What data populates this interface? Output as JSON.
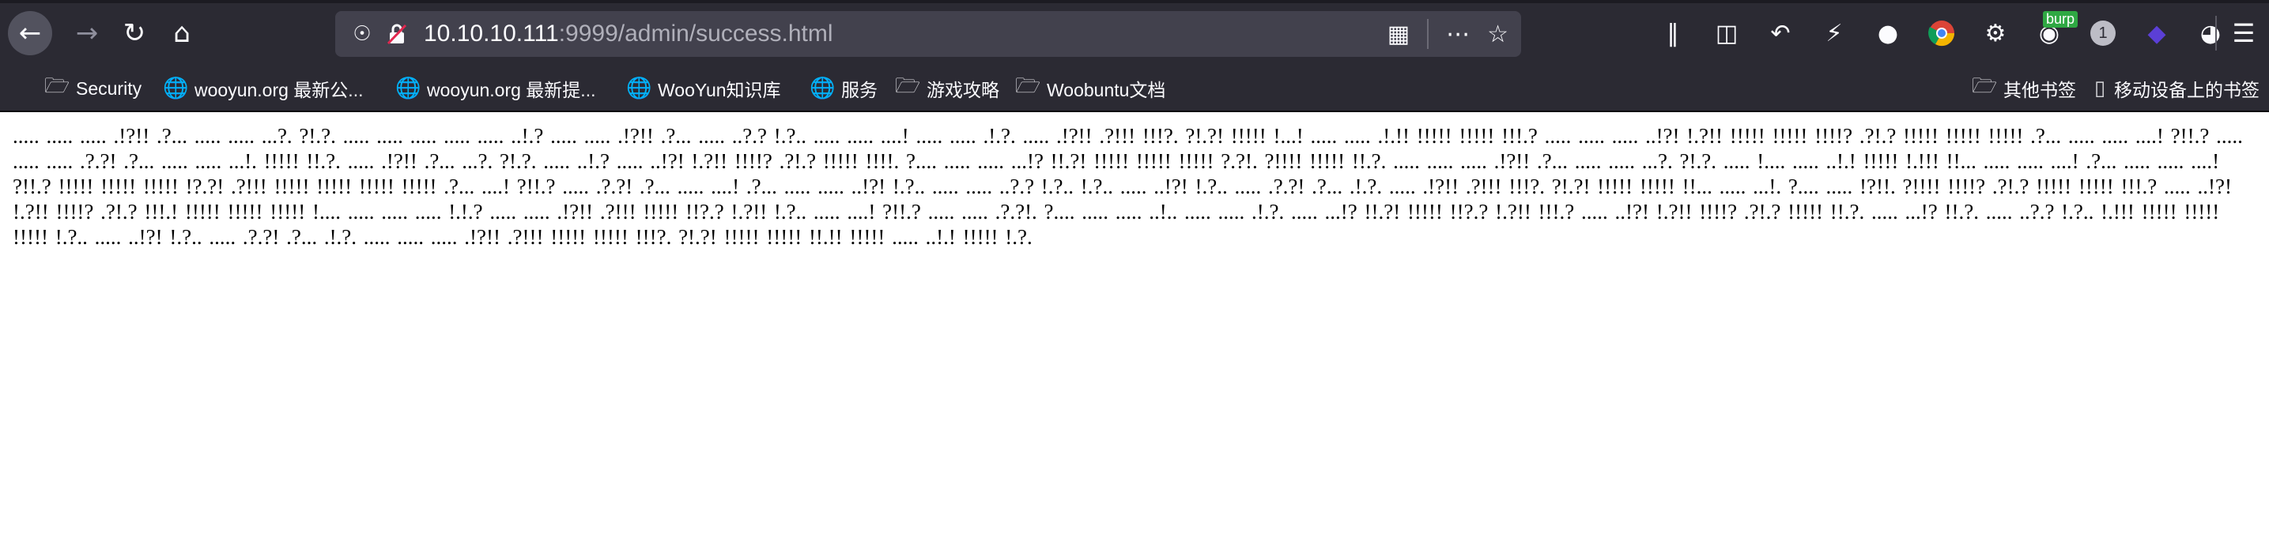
{
  "toolbar": {
    "back_icon": "back-arrow-icon",
    "forward_icon": "forward-arrow-icon",
    "reload_icon": "reload-icon",
    "home_icon": "home-icon",
    "url_host": "10.10.10.111",
    "url_rest": ":9999/admin/success.html",
    "burp_badge": "burp",
    "notification_count": "1"
  },
  "bookmarks": [
    {
      "label": "Security",
      "icon": "folder-icon"
    },
    {
      "label": "wooyun.org 最新公...",
      "icon": "globe-icon"
    },
    {
      "label": "wooyun.org 最新提...",
      "icon": "globe-icon"
    },
    {
      "label": "WooYun知识库",
      "icon": "globe-icon"
    },
    {
      "label": "服务",
      "icon": "globe-icon"
    },
    {
      "label": "游戏攻略",
      "icon": "folder-icon"
    },
    {
      "label": "Woobuntu文档",
      "icon": "folder-icon"
    }
  ],
  "bookmarks_right": [
    {
      "label": "其他书签",
      "icon": "folder-icon"
    },
    {
      "label": "移动设备上的书签",
      "icon": "mobile-bookmark-icon"
    }
  ],
  "page": {
    "text": "..... ..... ..... .!?!! .?... ..... ..... ...?. ?!.?. ..... ..... ..... ..... ..... ..!.? ..... ..... .!?!! .?... ..... ..?.? !.?.. ..... ..... ....! ..... ..... .!.?. ..... .!?!! .?!!! !!!?. ?!.?! !!!!! !...! ..... ..... .!.!! !!!!! !!!!! !!!.? ..... ..... ..... ..!?! !.?!! !!!!! !!!!! !!!!? .?!.? !!!!! !!!!! !!!!! .?... ..... ..... ....! ?!!.? ..... ..... ..... .?.?! .?... ..... ..... ...!. !!!!! !!.?. ..... .!?!! .?... ...?. ?!.?. ..... ..!.? ..... ..!?! !.?!! !!!!? .?!.? !!!!! !!!!. ?.... ..... ..... ...!? !!.?! !!!!! !!!!! !!!!! ?.?!. ?!!!! !!!!! !!.?. ..... ..... ..... .!?!! .?... ..... ..... ...?. ?!.?. ..... !.... ..... ..!.! !!!!! !.!!! !!... ..... ..... ....! .?... ..... ..... ....! ?!!.? !!!!! !!!!! !!!!! !?.?! .?!!! !!!!! !!!!! !!!!! !!!!! .?... ....! ?!!.? ..... .?.?! .?... ..... ....! .?... ..... ..... ..!?! !.?.. ..... ..... ..?.? !.?.. !.?.. ..... ..!?! !.?.. ..... .?.?! .?... .!.?. ..... .!?!! .?!!! !!!?. ?!.?! !!!!! !!!!! !!... ..... ...!. ?.... ..... !?!!. ?!!!! !!!!? .?!.? !!!!! !!!!! !!!.? ..... ..!?! !.?!! !!!!? .?!.? !!!.! !!!!! !!!!! !!!!! !.... ..... ..... ..... !.!.? ..... ..... .!?!! .?!!! !!!!! !!?.? !.?!! !.?.. ..... ....! ?!!.? ..... ..... .?.?!. ?.... ..... ..... ..!.. ..... ..... .!.?. ..... ...!? !!.?! !!!!! !!?.? !.?!! !!!.? ..... ..!?! !.?!! !!!!? .?!.? !!!!! !!.?. ..... ...!? !!.?. ..... ..?.? !.?.. !.!!! !!!!! !!!!! !!!!! !.?.. ..... ..!?! !.?.. ..... .?.?! .?... .!.?. ..... ..... ..... .!?!! .?!!! !!!!! !!!!! !!!?. ?!.?! !!!!! !!!!! !!.!! !!!!! ..... ..!.! !!!!! !.?."
  }
}
